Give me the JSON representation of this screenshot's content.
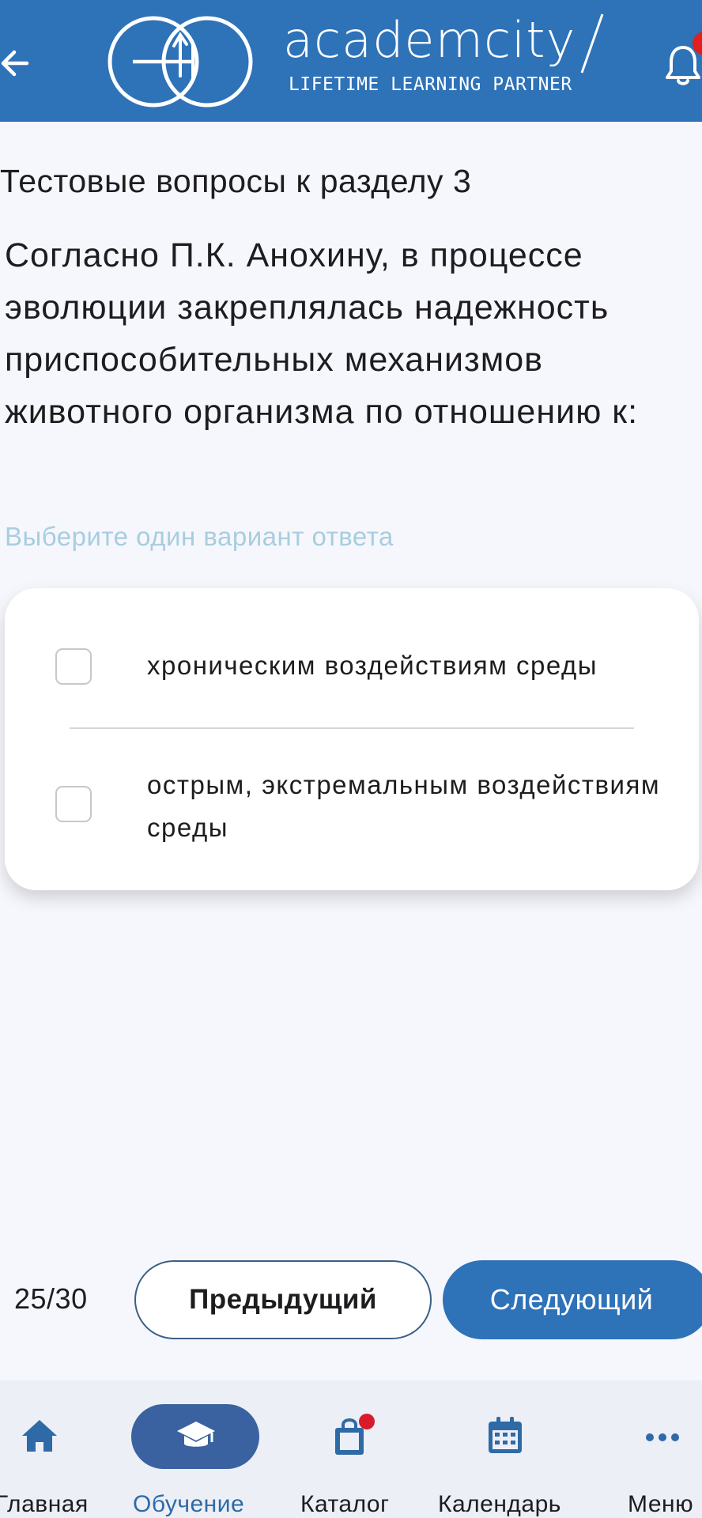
{
  "header": {
    "logo_word": "academcity",
    "logo_tagline": "LIFETIME LEARNING PARTNER",
    "background_color": "#2e72b8",
    "back_icon": "arrow-left-icon",
    "notification_icon": "bell-icon"
  },
  "test": {
    "section_title": "Тестовые вопросы к разделу 3",
    "question": "Согласно П.К. Анохину, в процессе эволюции закреплялась надежность приспособительных механизмов животного организма по отношению к:",
    "hint": "Выберите один вариант ответа",
    "answers": [
      {
        "label": "хроническим воздействиям среды",
        "checked": false
      },
      {
        "label": "острым, экстремальным воздействиям среды",
        "checked": false
      }
    ]
  },
  "pager": {
    "counter": "25/30",
    "prev_label": "Предыдущий",
    "next_label": "Следующий"
  },
  "nav": {
    "items": [
      {
        "label": "Главная",
        "icon": "home-icon",
        "active": false
      },
      {
        "label": "Обучение",
        "icon": "graduation-cap-icon",
        "active": true
      },
      {
        "label": "Каталог",
        "icon": "shopping-bag-icon",
        "active": false
      },
      {
        "label": "Календарь",
        "icon": "calendar-icon",
        "active": false
      },
      {
        "label": "Меню",
        "icon": "more-icon",
        "active": false
      }
    ]
  }
}
